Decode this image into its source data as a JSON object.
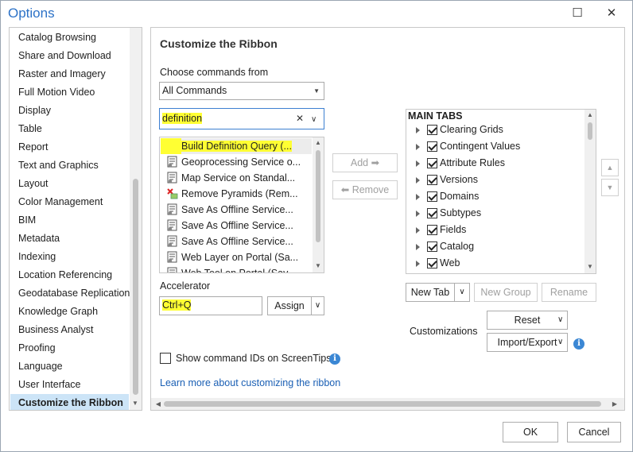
{
  "window": {
    "title": "Options",
    "maximize_glyph": "☐",
    "close_glyph": "✕"
  },
  "categories": [
    {
      "label": "Catalog Browsing",
      "selected": false
    },
    {
      "label": "Share and Download",
      "selected": false
    },
    {
      "label": "Raster and Imagery",
      "selected": false
    },
    {
      "label": "Full Motion Video",
      "selected": false
    },
    {
      "label": "Display",
      "selected": false
    },
    {
      "label": "Table",
      "selected": false
    },
    {
      "label": "Report",
      "selected": false
    },
    {
      "label": "Text and Graphics",
      "selected": false
    },
    {
      "label": "Layout",
      "selected": false
    },
    {
      "label": "Color Management",
      "selected": false
    },
    {
      "label": "BIM",
      "selected": false
    },
    {
      "label": "Metadata",
      "selected": false
    },
    {
      "label": "Indexing",
      "selected": false
    },
    {
      "label": "Location Referencing",
      "selected": false
    },
    {
      "label": "Geodatabase Replication",
      "selected": false
    },
    {
      "label": "Knowledge Graph",
      "selected": false
    },
    {
      "label": "Business Analyst",
      "selected": false
    },
    {
      "label": "Proofing",
      "selected": false
    },
    {
      "label": "Language",
      "selected": false
    },
    {
      "label": "User Interface",
      "selected": false
    },
    {
      "label": "Customize the Ribbon",
      "selected": true
    }
  ],
  "panel": {
    "heading": "Customize the Ribbon",
    "choose_label": "Choose commands from",
    "choose_value": "All Commands",
    "search_value": "definition",
    "clear_glyph": "✕",
    "commands": [
      {
        "label": "Build Definition Query (...",
        "icon": "blank-icon",
        "highlight": true
      },
      {
        "label": "Geoprocessing Service o...",
        "icon": "script-tool-icon",
        "highlight": false
      },
      {
        "label": "Map Service on Standal...",
        "icon": "script-tool-icon",
        "highlight": false
      },
      {
        "label": "Remove Pyramids (Rem...",
        "icon": "remove-pyramids-icon",
        "highlight": false
      },
      {
        "label": "Save As Offline Service...",
        "icon": "script-tool-icon",
        "highlight": false
      },
      {
        "label": "Save As Offline Service...",
        "icon": "script-tool-icon",
        "highlight": false
      },
      {
        "label": "Save As Offline Service...",
        "icon": "script-tool-icon",
        "highlight": false
      },
      {
        "label": "Web Layer on Portal (Sa...",
        "icon": "script-tool-icon",
        "highlight": false
      },
      {
        "label": "Web Tool on Portal (Sav...",
        "icon": "script-tool-icon",
        "highlight": false
      }
    ],
    "add_label": "Add",
    "remove_label": "Remove",
    "accelerator_label": "Accelerator",
    "accelerator_value": "Ctrl+Q",
    "assign_label": "Assign",
    "show_ids_label": "Show command IDs on ScreenTips",
    "learn_more_label": "Learn more about customizing the ribbon",
    "tabs_header": "MAIN TABS",
    "tabs": [
      {
        "label": "Clearing Grids",
        "checked": true
      },
      {
        "label": "Contingent Values",
        "checked": true
      },
      {
        "label": "Attribute Rules",
        "checked": true
      },
      {
        "label": "Versions",
        "checked": true
      },
      {
        "label": "Domains",
        "checked": true
      },
      {
        "label": "Subtypes",
        "checked": true
      },
      {
        "label": "Fields",
        "checked": true
      },
      {
        "label": "Catalog",
        "checked": true
      },
      {
        "label": "Web",
        "checked": true
      }
    ],
    "new_tab_label": "New Tab",
    "new_group_label": "New Group",
    "rename_label": "Rename",
    "customizations_label": "Customizations",
    "reset_label": "Reset",
    "import_export_label": "Import/Export",
    "info_glyph": "i"
  },
  "footer": {
    "ok_label": "OK",
    "cancel_label": "Cancel"
  }
}
